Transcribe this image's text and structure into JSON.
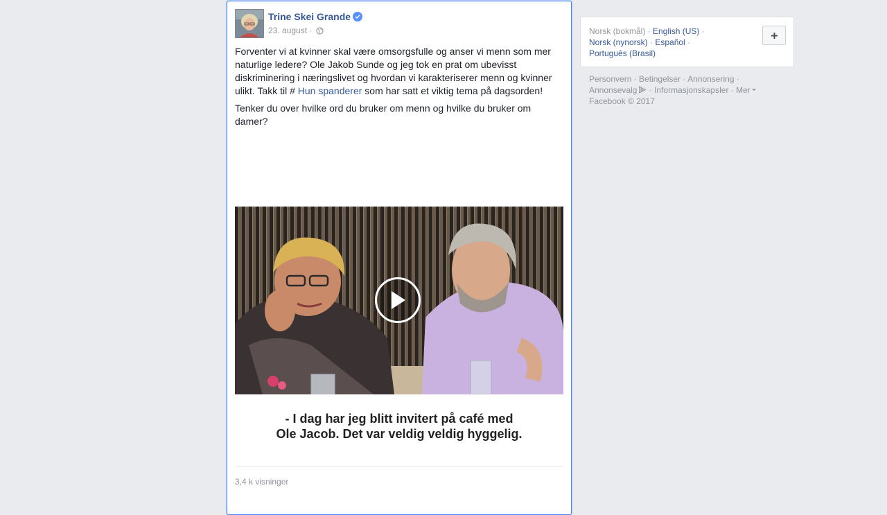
{
  "post": {
    "author": "Trine Skei Grande",
    "date": "23. august",
    "paragraph1_before": "Forventer vi at kvinner skal være omsorgsfulle og anser vi menn som mer naturlige ledere? Ole Jakob Sunde og jeg tok en prat om ubevisst diskriminering i næringslivet og hvordan vi karakteriserer menn og kvinner ulikt. Takk til # ",
    "hashtag": "Hun spanderer",
    "paragraph1_after": " som har satt et viktig tema på dagsorden!",
    "paragraph2": "Tenker du over hvilke ord du bruker om menn og hvilke du bruker om damer?",
    "subtitle_line1": "- I dag har jeg blitt invitert på café med",
    "subtitle_line2": "Ole Jacob. Det var veldig veldig hyggelig.",
    "views": "3,4 k visninger"
  },
  "languages": {
    "current": "Norsk (bokmål)",
    "others": [
      "English (US)",
      "Norsk (nynorsk)",
      "Español",
      "Português (Brasil)"
    ]
  },
  "footer": {
    "links": [
      "Personvern",
      "Betingelser",
      "Annonsering",
      "Annonsevalg",
      "Informasjonskapsler",
      "Mer"
    ],
    "copyright": "Facebook © 2017"
  },
  "colors": {
    "link": "#365899",
    "muted": "#90949c",
    "page_bg": "#e9ebee",
    "focus_border": "#4080ff",
    "verified": "#5890ff"
  },
  "icons": {
    "verified": "verified-badge-icon",
    "audience": "globe-icon",
    "play": "play-icon",
    "add_language": "plus-icon",
    "adchoices": "adchoices-icon",
    "more": "caret-down-icon"
  }
}
